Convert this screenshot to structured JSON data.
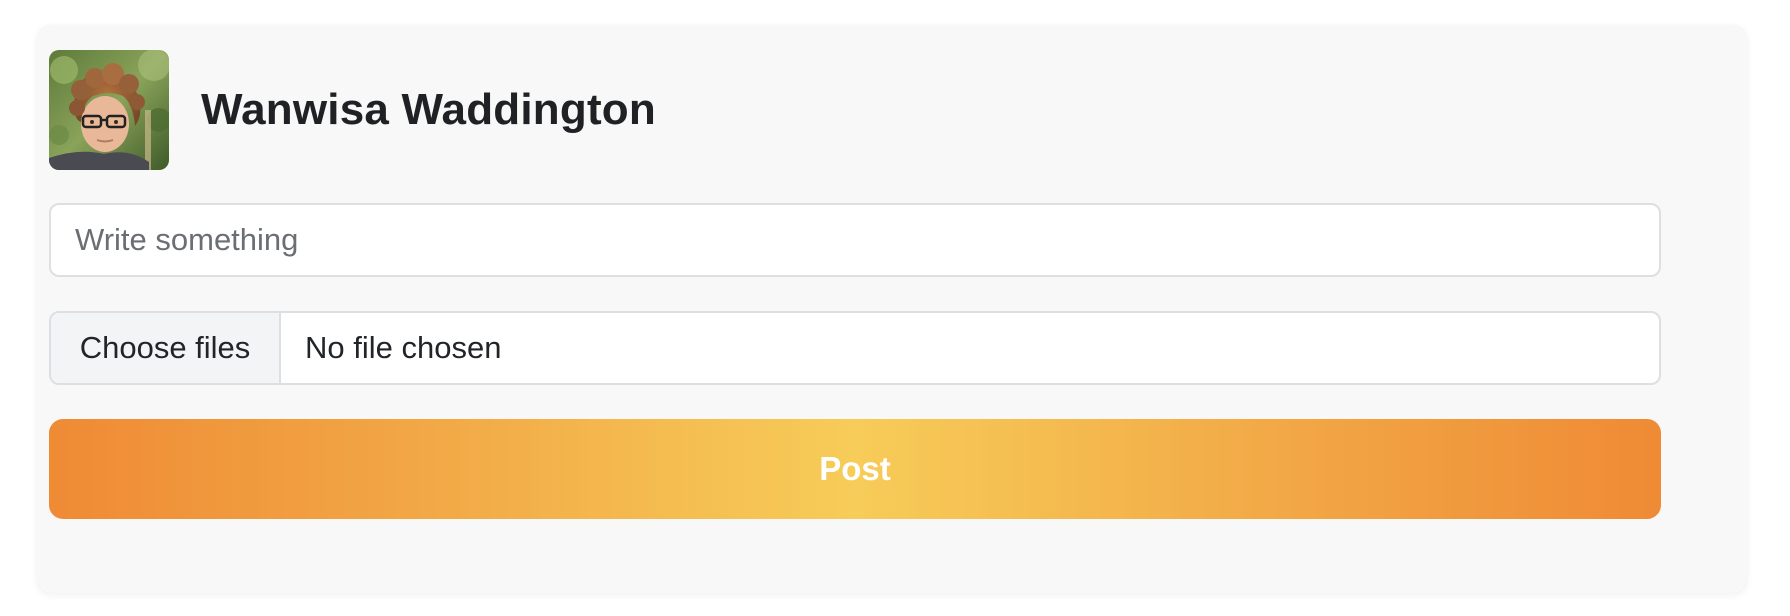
{
  "composer": {
    "user_name": "Wanwisa Waddington",
    "avatar": "profile-photo",
    "text_placeholder": "Write something",
    "text_value": "",
    "file_button_label": "Choose files",
    "file_status": "No file chosen",
    "post_button_label": "Post"
  },
  "colors": {
    "card_background": "#f8f8f8",
    "border": "#dedfe2",
    "file_button_background": "#f3f4f6",
    "button_gradient_edge": "#ef8a35",
    "button_gradient_center": "#f7cc58",
    "button_text": "#ffffff",
    "name_text": "#1f2125"
  }
}
